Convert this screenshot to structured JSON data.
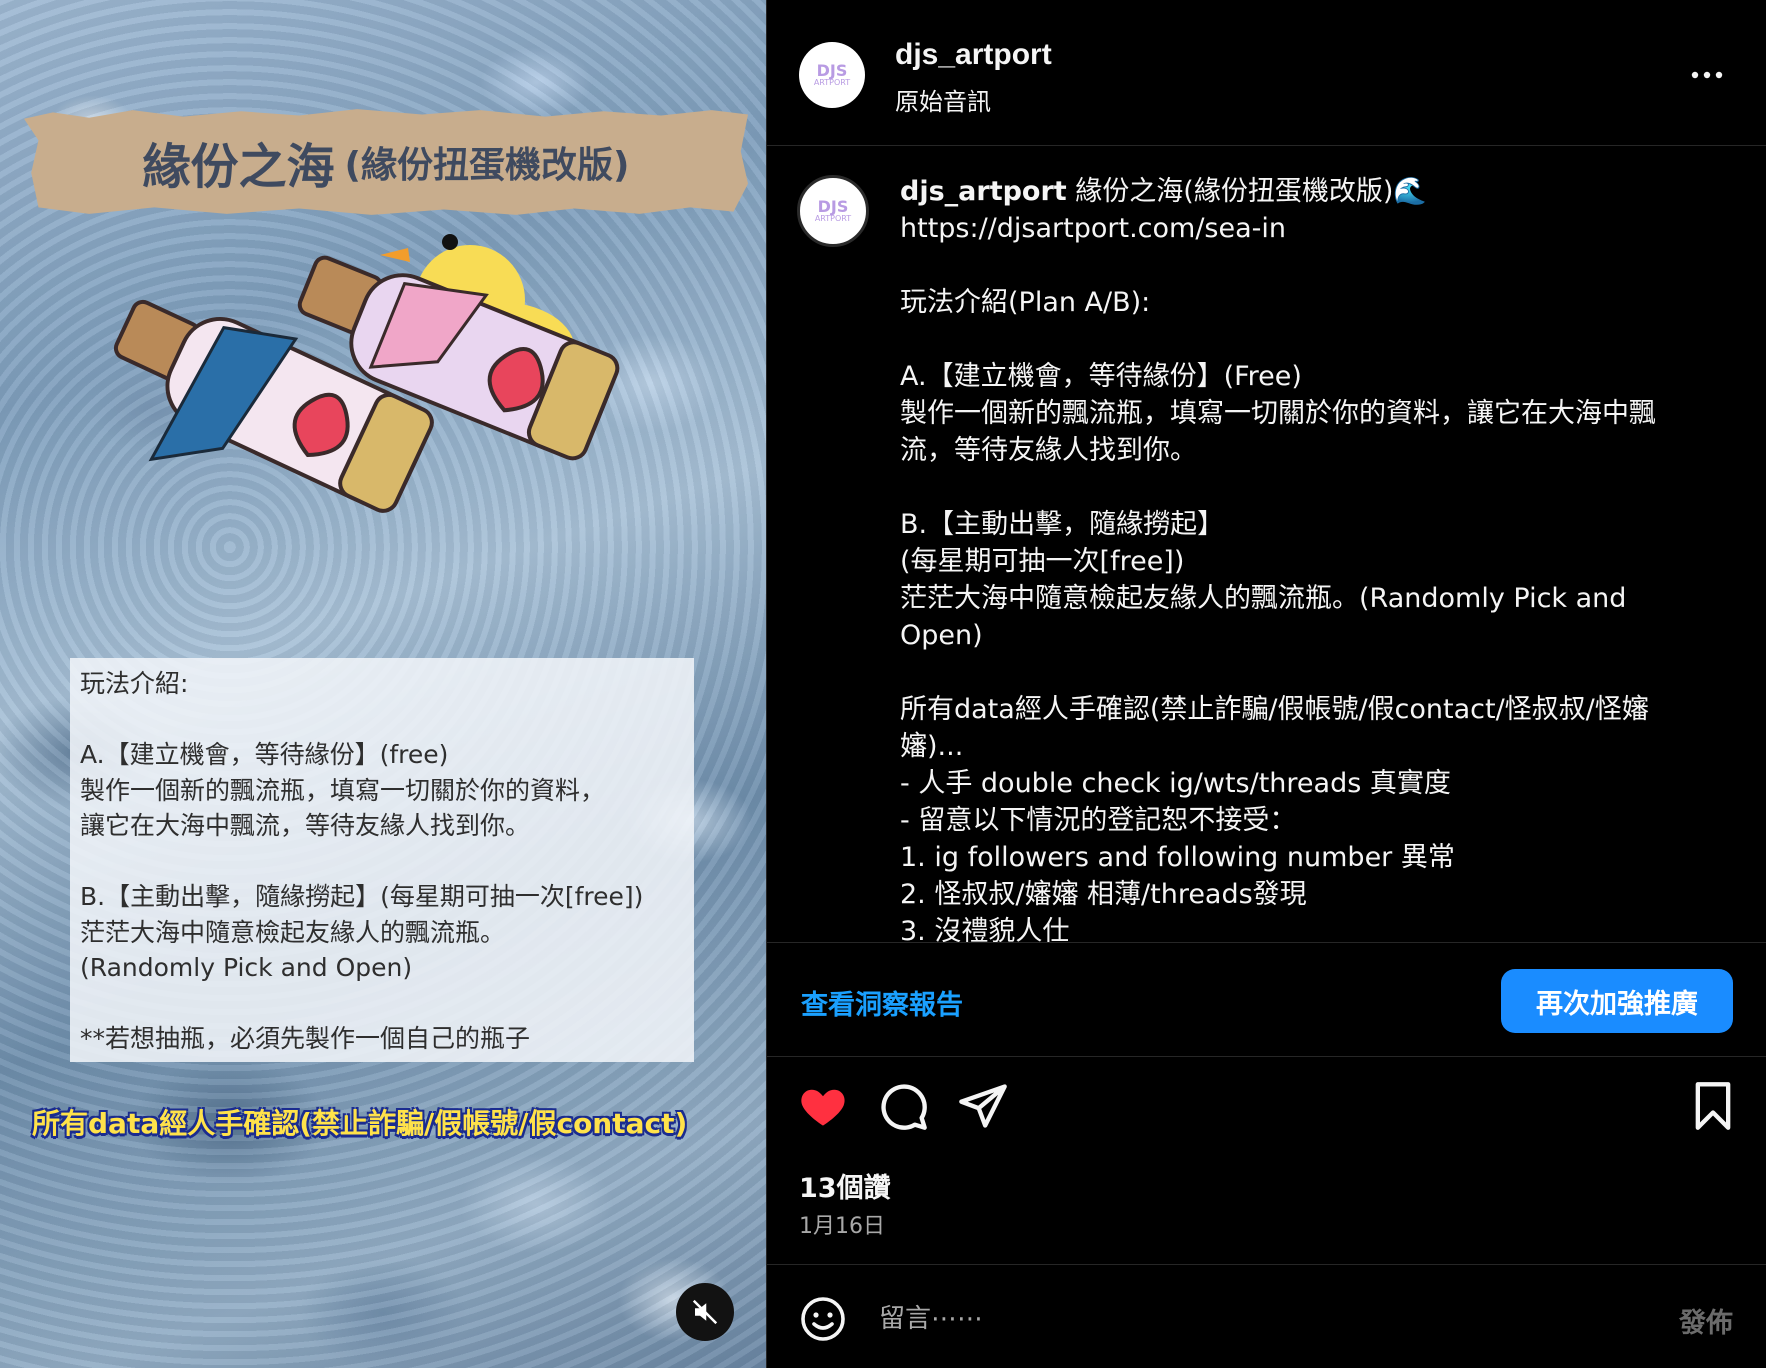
{
  "media": {
    "title_main": "緣份之海",
    "title_sub": "(緣份扭蛋機改版)",
    "howto_text": "玩法介紹:\n\nA.【建立機會，等待緣份】(free)\n製作一個新的飄流瓶，填寫一切關於你的資料，\n讓它在大海中飄流，等待友緣人找到你。\n\nB.【主動出擊，隨緣撈起】(每星期可抽一次[free])\n茫茫大海中隨意檢起友緣人的飄流瓶。\n(Randomly Pick and Open)\n\n**若想抽瓶，必須先製作一個自己的瓶子",
    "yellow_caption": "所有data經人手確認(禁止詐騙/假帳號/假contact)",
    "avatar_logo": "DJS ARTPORT"
  },
  "header": {
    "username": "djs_artport",
    "audio": "原始音訊"
  },
  "caption": {
    "username": "djs_artport",
    "first_line": " 緣份之海(緣份扭蛋機改版)🌊",
    "body": "https://djsartport.com/sea-in\n\n玩法介紹(Plan A/B):\n\nA.【建立機會，等待緣份】(Free)\n製作一個新的飄流瓶，填寫一切關於你的資料，讓它在大海中飄流，等待友緣人找到你。\n\nB.【主動出擊，隨緣撈起】\n(每星期可抽一次[free])\n茫茫大海中隨意檢起友緣人的飄流瓶。(Randomly Pick and Open)\n\n所有data經人手確認(禁止詐騙/假帳號/假contact/怪叔叔/怪嬸嬸)...\n- 人手 double check ig/wts/threads 真實度\n- 留意以下情況的登記恕不接受：\n1. ig followers and following number 異常\n2. 怪叔叔/嬸嬸 相薄/threads發現\n3. 沒禮貌人仕"
  },
  "insights": {
    "view_label": "查看洞察報告",
    "boost_label": "再次加強推廣"
  },
  "stats": {
    "likes": "13個讚",
    "date": "1月16日"
  },
  "comment": {
    "placeholder": "留言⋯⋯",
    "post_label": "發佈"
  },
  "colors": {
    "like": "#ff3040",
    "accent": "#1a8cff",
    "link": "#1aa0ff"
  }
}
